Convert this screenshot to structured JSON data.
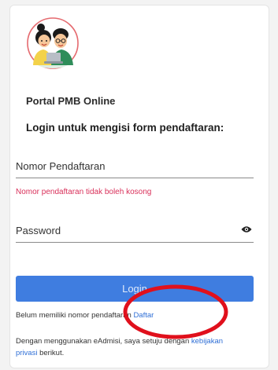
{
  "brand": {
    "logo_icon": "students-mascot-icon",
    "portal_title": "Portal PMB Online"
  },
  "form": {
    "heading": "Login untuk mengisi form pendaftaran:",
    "nomor": {
      "placeholder": "Nomor Pendaftaran",
      "value": "",
      "error": "Nomor pendaftaran tidak boleh kosong"
    },
    "password": {
      "placeholder": "Password",
      "value": "",
      "toggle_icon": "eye-icon"
    },
    "login_label": "Login"
  },
  "register": {
    "prefix": "Belum memiliki nomor pendaftaran",
    "link": "Daftar"
  },
  "consent": {
    "prefix": "Dengan menggunakan eAdmisi, saya setuju dengan",
    "link": "kebijakan privasi",
    "suffix": "berikut."
  },
  "colors": {
    "primary": "#3f7de0",
    "error": "#d9305a",
    "link": "#2f6fd6",
    "annotation": "#e0101c"
  }
}
